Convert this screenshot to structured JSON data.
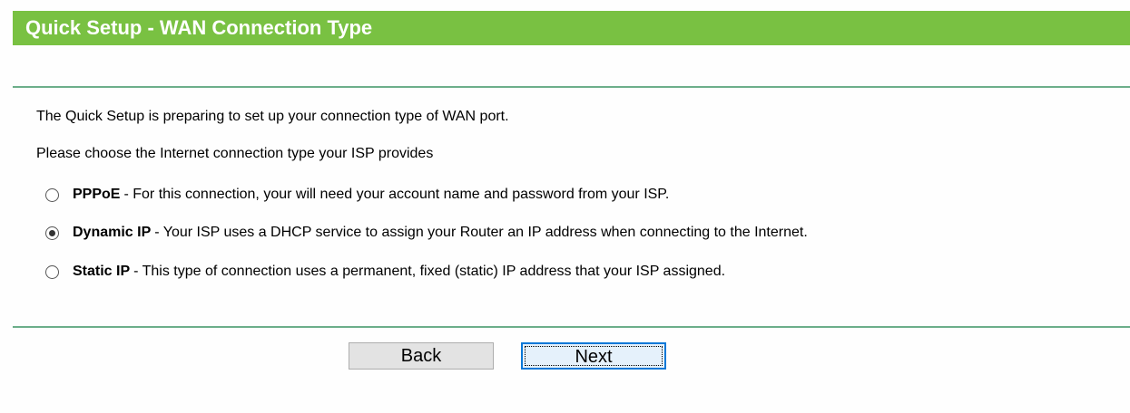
{
  "header": {
    "title": "Quick Setup - WAN Connection Type"
  },
  "intro": {
    "line1": "The Quick Setup is preparing to set up your connection type of WAN port.",
    "line2": "Please choose the Internet connection type your ISP provides"
  },
  "options": [
    {
      "name": "PPPoE",
      "desc": "- For this connection, your will need your account name and password from your ISP.",
      "checked": false
    },
    {
      "name": "Dynamic IP",
      "desc": "- Your ISP uses a DHCP service to assign your Router an IP address when connecting to the Internet.",
      "checked": true
    },
    {
      "name": "Static IP",
      "desc": "- This type of connection uses a permanent, fixed (static) IP address that your ISP assigned.",
      "checked": false
    }
  ],
  "buttons": {
    "back": "Back",
    "next": "Next"
  },
  "colors": {
    "header_bg": "#79c142",
    "divider": "#6cae8a",
    "focus_border": "#0a78d7"
  }
}
